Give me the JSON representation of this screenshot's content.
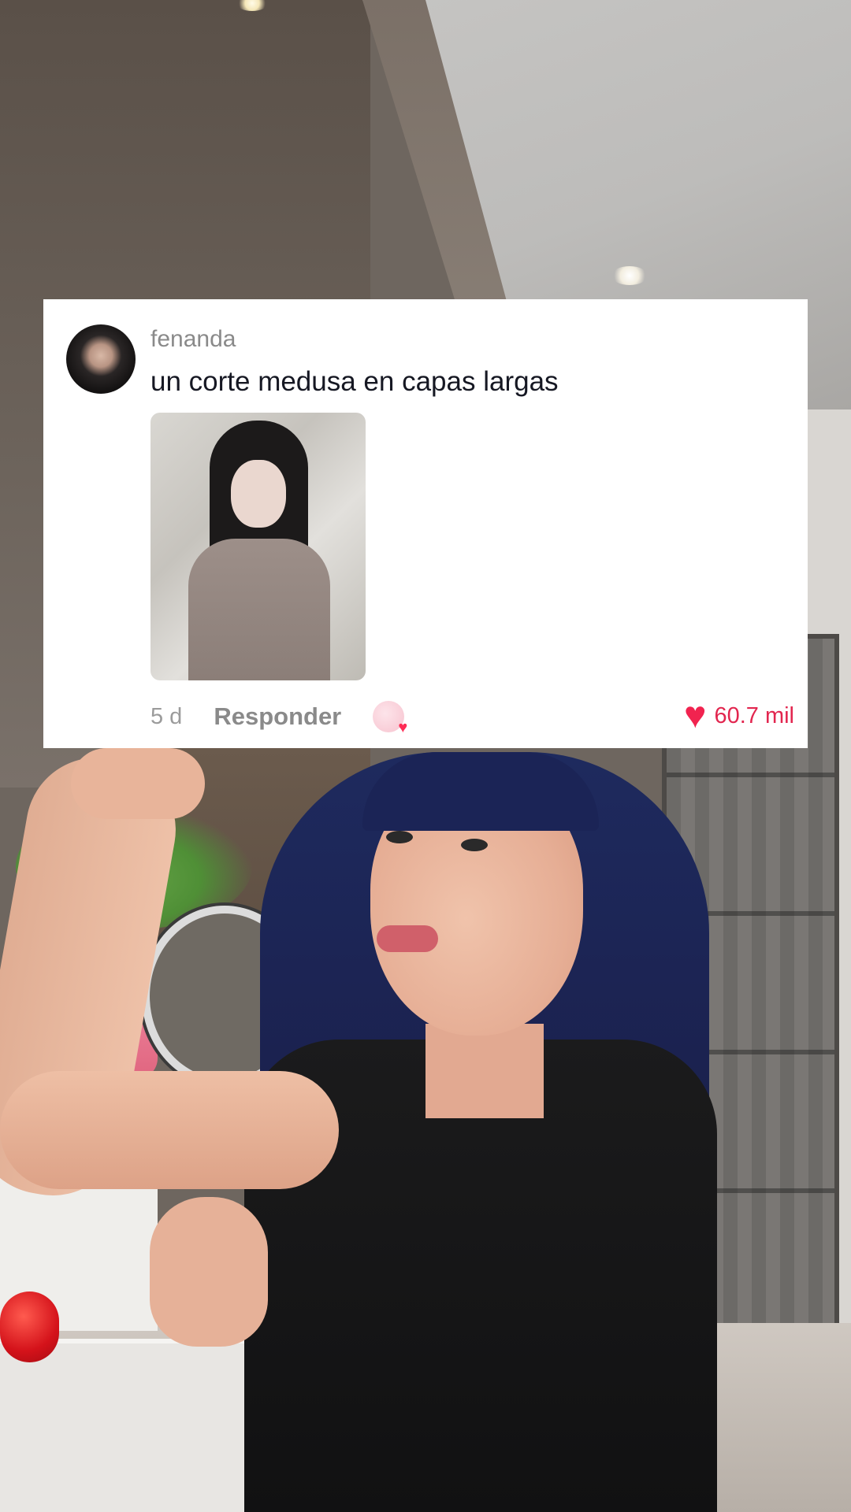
{
  "comment": {
    "username": "fenanda",
    "text": "un corte medusa en capas largas",
    "time": "5 d",
    "reply_label": "Responder",
    "like_count": "60.7 mil"
  },
  "icons": {
    "avatar": "user-avatar",
    "attached_image": "hairstyle-photo",
    "creator_like": "creator-liked-badge-icon",
    "like": "heart-icon"
  },
  "colors": {
    "like": "#fe2c55",
    "card_background": "#ffffff",
    "username": "#8a8a8a",
    "comment_text": "#161823"
  }
}
